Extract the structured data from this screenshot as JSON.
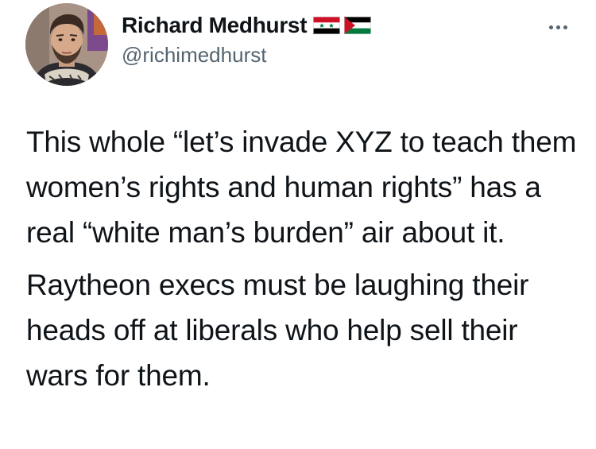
{
  "tweet": {
    "author": {
      "display_name": "Richard Medhurst",
      "handle": "@richimedhurst",
      "avatar_icon": "profile-photo",
      "flags": [
        "syria-flag-icon",
        "palestine-flag-icon"
      ]
    },
    "more_icon": "more-options-icon",
    "paragraphs": [
      "This whole “let’s invade XYZ to teach them women’s rights and human rights” has a real “white man’s burden” air about it.",
      "Raytheon execs must be laughing their heads off at liberals who help sell their wars for them."
    ]
  },
  "colors": {
    "text": "#0f1419",
    "secondary_text": "#536471",
    "background": "#ffffff"
  }
}
